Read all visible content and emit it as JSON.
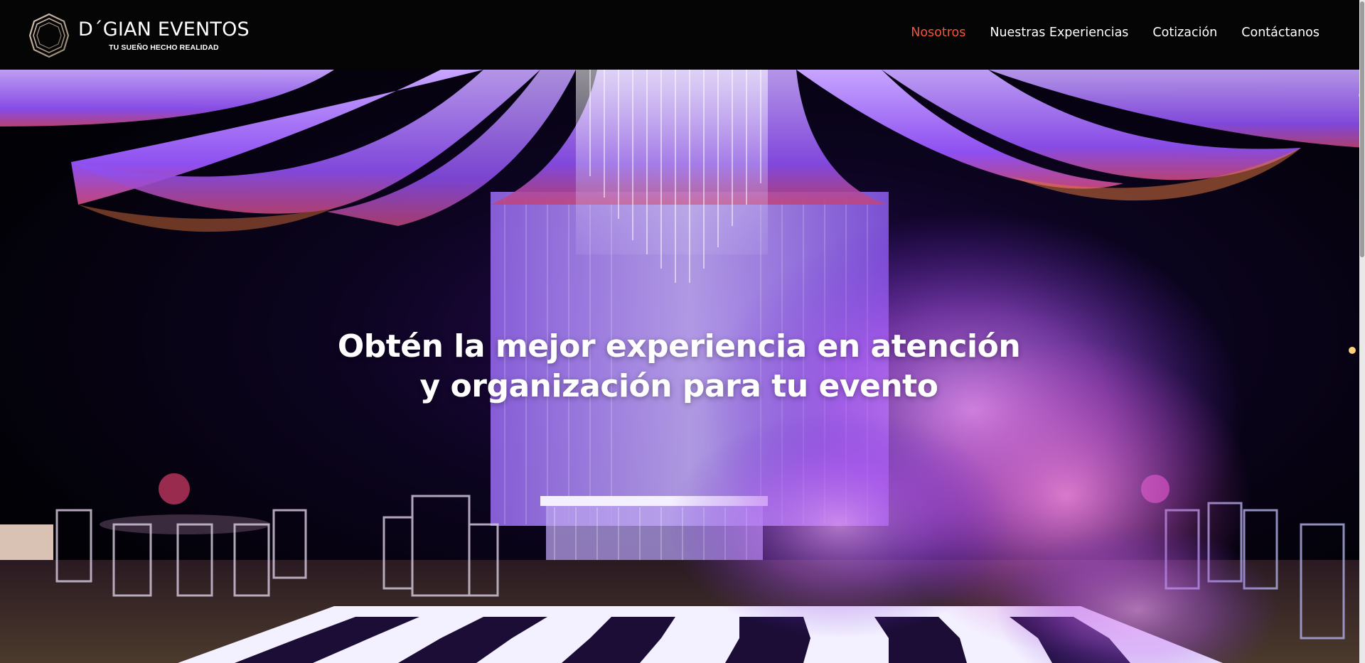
{
  "header": {
    "brand_name": "D´GIAN EVENTOS",
    "brand_tagline": "TU SUEÑO HECHO REALIDAD",
    "nav": [
      {
        "label": "Nosotros",
        "active": true
      },
      {
        "label": "Nuestras Experiencias",
        "active": false
      },
      {
        "label": "Cotización",
        "active": false
      },
      {
        "label": "Contáctanos",
        "active": false
      }
    ]
  },
  "hero": {
    "heading": "Obtén la mejor experiencia en atención y organización para tu evento",
    "image_subject": "event venue with purple draped ceiling, crystal chandelier, fog and checkered dance floor"
  },
  "colors": {
    "header_bg": "#050505",
    "nav_active": "#f0553a",
    "nav_text": "#ffffff",
    "accent_purple": "#8a3cf0",
    "accent_magenta": "#d23cc8"
  }
}
